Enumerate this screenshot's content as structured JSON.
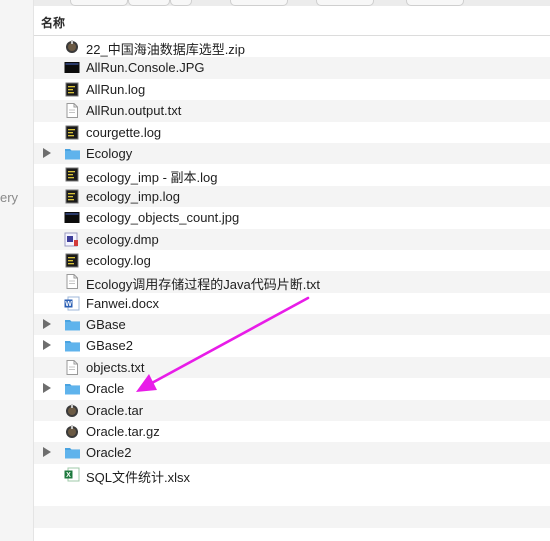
{
  "header": {
    "name_column": "名称"
  },
  "sidebar": {
    "fragment": "ery"
  },
  "files": [
    {
      "name": "22_中国海油数据库选型.zip",
      "icon": "archive-icon",
      "folder": false
    },
    {
      "name": "AllRun.Console.JPG",
      "icon": "image-icon",
      "folder": false
    },
    {
      "name": "AllRun.log",
      "icon": "log-icon",
      "folder": false
    },
    {
      "name": "AllRun.output.txt",
      "icon": "text-file-icon",
      "folder": false
    },
    {
      "name": "courgette.log",
      "icon": "log-icon",
      "folder": false
    },
    {
      "name": "Ecology",
      "icon": "folder-icon",
      "folder": true
    },
    {
      "name": "ecology_imp - 副本.log",
      "icon": "log-icon",
      "folder": false
    },
    {
      "name": "ecology_imp.log",
      "icon": "log-icon",
      "folder": false
    },
    {
      "name": "ecology_objects_count.jpg",
      "icon": "image-icon",
      "folder": false
    },
    {
      "name": "ecology.dmp",
      "icon": "dmp-file-icon",
      "folder": false
    },
    {
      "name": "ecology.log",
      "icon": "log-icon",
      "folder": false
    },
    {
      "name": "Ecology调用存储过程的Java代码片断.txt",
      "icon": "text-file-icon",
      "folder": false
    },
    {
      "name": "Fanwei.docx",
      "icon": "word-doc-icon",
      "folder": false
    },
    {
      "name": "GBase",
      "icon": "folder-icon",
      "folder": true
    },
    {
      "name": "GBase2",
      "icon": "folder-icon",
      "folder": true
    },
    {
      "name": "objects.txt",
      "icon": "text-file-icon",
      "folder": false
    },
    {
      "name": "Oracle",
      "icon": "folder-icon",
      "folder": true
    },
    {
      "name": "Oracle.tar",
      "icon": "archive-icon",
      "folder": false
    },
    {
      "name": "Oracle.tar.gz",
      "icon": "archive-icon",
      "folder": false
    },
    {
      "name": "Oracle2",
      "icon": "folder-icon",
      "folder": true
    },
    {
      "name": "SQL文件统计.xlsx",
      "icon": "excel-icon",
      "folder": false
    }
  ],
  "colors": {
    "folder": "#5fb3ec",
    "folder_tab": "#4aa3e0",
    "annotation_arrow": "#e81ce8",
    "alt_row": "#f4f4f4"
  }
}
